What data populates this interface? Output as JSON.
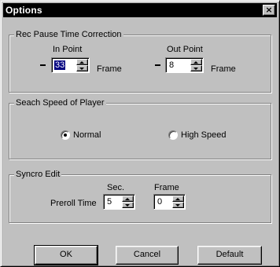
{
  "window": {
    "title": "Options",
    "close_glyph": "×"
  },
  "rec_pause": {
    "group_label": "Rec Pause Time Correction",
    "in_point": {
      "label": "In Point",
      "sign": "-",
      "value": "33",
      "unit": "Frame"
    },
    "out_point": {
      "label": "Out Point",
      "sign": "-",
      "value": "8",
      "unit": "Frame"
    }
  },
  "search_speed": {
    "group_label": "Seach Speed of Player",
    "options": [
      {
        "label": "Normal",
        "selected": true
      },
      {
        "label": "High Speed",
        "selected": false
      }
    ]
  },
  "syncro_edit": {
    "group_label": "Syncro Edit",
    "preroll_label": "Preroll Time",
    "sec": {
      "label": "Sec.",
      "value": "5"
    },
    "frame": {
      "label": "Frame",
      "value": "0"
    }
  },
  "buttons": {
    "ok": "OK",
    "cancel": "Cancel",
    "default": "Default"
  },
  "icons": {
    "close": "close-icon",
    "spin_up": "spin-up-arrow-icon",
    "spin_down": "spin-down-arrow-icon",
    "radio": "radio-button-icon"
  },
  "colors": {
    "dialog_face": "#c0c0c0",
    "titlebar": "#000000",
    "title_text": "#ffffff",
    "selection": "#000080"
  }
}
